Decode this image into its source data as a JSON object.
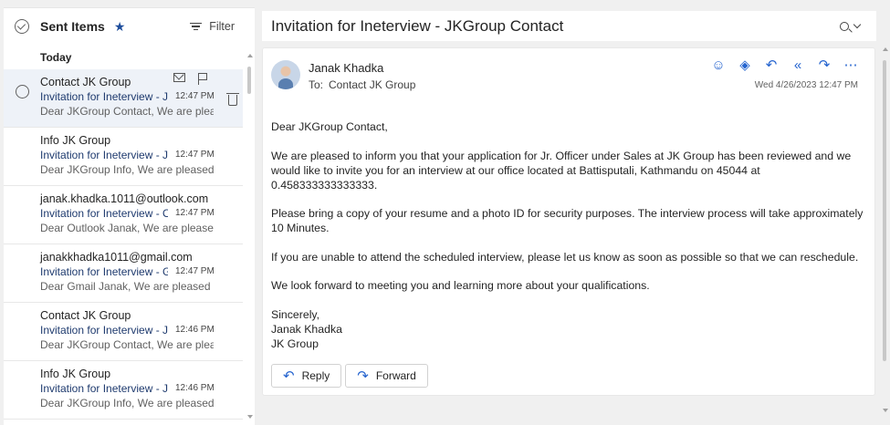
{
  "folder": {
    "name": "Sent Items",
    "filter_label": "Filter"
  },
  "group_label": "Today",
  "messages": [
    {
      "sender": "Contact JK Group",
      "subject": "Invitation for Ineterview - JKGroup Contact",
      "time": "12:47 PM",
      "preview": "Dear JKGroup Contact, We are pleased to inform you"
    },
    {
      "sender": "Info JK Group",
      "subject": "Invitation for Ineterview - JKGroup Info",
      "time": "12:47 PM",
      "preview": "Dear JKGroup Info, We are pleased to inform you"
    },
    {
      "sender": "janak.khadka.1011@outlook.com",
      "subject": "Invitation for Ineterview - Outlook Janak",
      "time": "12:47 PM",
      "preview": "Dear Outlook Janak, We are pleased to inform you"
    },
    {
      "sender": "janakkhadka1011@gmail.com",
      "subject": "Invitation for Ineterview - Gmail Janak",
      "time": "12:47 PM",
      "preview": "Dear Gmail Janak, We are pleased to inform you"
    },
    {
      "sender": "Contact JK Group",
      "subject": "Invitation for Ineterview - JKGroup Contact",
      "time": "12:46 PM",
      "preview": "Dear JKGroup Contact, We are pleased to inform you"
    },
    {
      "sender": "Info JK Group",
      "subject": "Invitation for Ineterview - JKGroup Info",
      "time": "12:46 PM",
      "preview": "Dear JKGroup Info, We are pleased to inform you"
    }
  ],
  "reading": {
    "subject": "Invitation for Ineterview - JKGroup Contact",
    "from": "Janak Khadka",
    "to_label": "To:",
    "to": "Contact JK Group",
    "date": "Wed 4/26/2023 12:47 PM",
    "body": [
      "Dear JKGroup Contact,",
      "We are pleased to inform you that your application for Jr. Officer under Sales at JK Group has been reviewed and we would like to invite you for an interview at our office located at Battisputali, Kathmandu on 45044 at 0.458333333333333.",
      "Please bring a copy of your resume and a photo ID for security purposes. The interview process will take approximately 10 Minutes.",
      "If you are unable to attend the scheduled interview, please let us know as soon as possible so that we can reschedule.",
      "We look forward to meeting you and learning more about your qualifications."
    ],
    "signoff": [
      "Sincerely,",
      "Janak Khadka",
      "JK Group"
    ],
    "reply_label": "Reply",
    "forward_label": "Forward"
  },
  "icons": {
    "accent": "#2564cf",
    "star": "#1f4e9c",
    "action_icons": [
      "emoji-icon",
      "sticker-icon",
      "reply-icon",
      "reply-all-icon",
      "forward-icon",
      "more-icon"
    ]
  }
}
